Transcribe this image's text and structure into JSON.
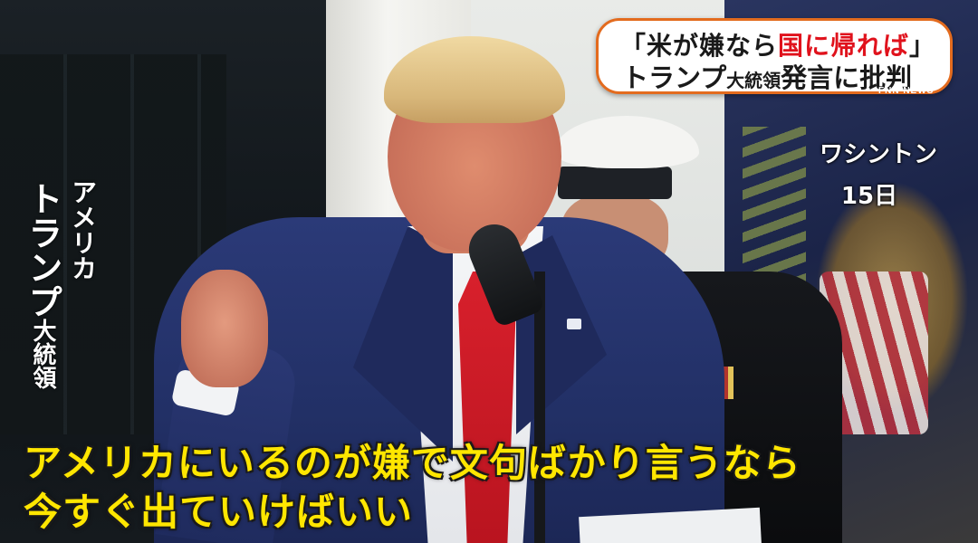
{
  "headline": {
    "line1_pre": "「米が嫌なら",
    "line1_red": "国に帰れば",
    "line1_post": "」",
    "line2_main": "トランプ",
    "line2_small": "大統領",
    "line2_rest": "発言に批判"
  },
  "network_logo": "FNN NEWS",
  "location": "ワシントン",
  "date": "15日",
  "speaker": {
    "country": "アメリカ",
    "name": "トランプ",
    "title": "大統領"
  },
  "subtitle": {
    "line1": "アメリカにいるのが嫌で文句ばかり言うなら",
    "line2": "今すぐ出ていけばいい"
  },
  "colors": {
    "accent_orange": "#e36b1e",
    "headline_red": "#e0121c",
    "subtitle_yellow": "#ffe600"
  }
}
